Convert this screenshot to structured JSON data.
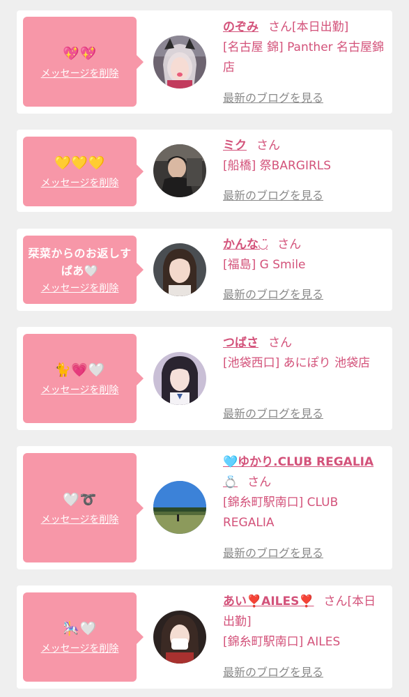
{
  "delete_label": "メッセージを削除",
  "blog_label": "最新のブログを見る",
  "san_label": "さん",
  "cards": [
    {
      "message": "💖💖",
      "name": "のぞみ",
      "suffix": "さん[本日出勤]",
      "shop": "[名古屋 錦] Panther 名古屋錦店"
    },
    {
      "message": "💛💛💛",
      "name": "ミク",
      "suffix": "さん",
      "shop": "[船橋] 祭BARGIRLS"
    },
    {
      "message": "栞菜からのお返しすぱあ🤍",
      "name": "かんな◡̈",
      "suffix": "さん",
      "shop": "[福島] G Smile"
    },
    {
      "message": "🐈💗🤍",
      "name": "つばさ",
      "suffix": "さん",
      "shop": "[池袋西口] あにぽり 池袋店"
    },
    {
      "message": "🤍➰",
      "name": "🩵ゆかり.CLUB REGALIA💍",
      "suffix": "さん",
      "shop": "[錦糸町駅南口] CLUB REGALIA"
    },
    {
      "message": "🎠🤍",
      "name": "あい❣️AILES❣️",
      "suffix": "さん[本日出勤]",
      "shop": "[錦糸町駅南口] AILES"
    }
  ],
  "colors": {
    "bubble": "#f797a8",
    "name": "#d3527a",
    "link": "#8a8a8a",
    "background": "#efefef"
  }
}
